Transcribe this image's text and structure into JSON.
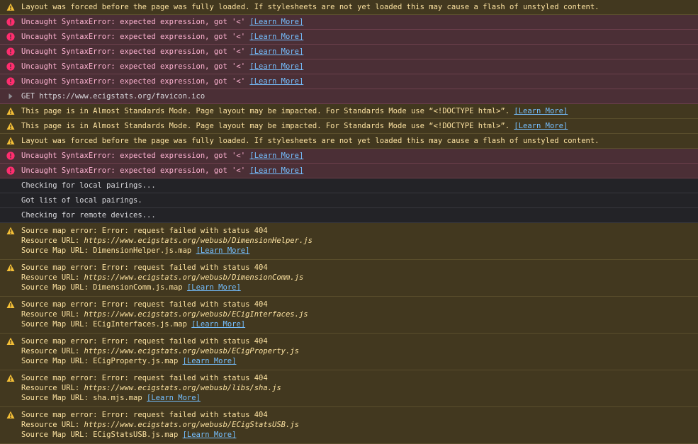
{
  "learn_more": "[Learn More]",
  "messages": [
    {
      "level": "warn",
      "text": "Layout was forced before the page was fully loaded. If stylesheets are not yet loaded this may cause a flash of unstyled content."
    },
    {
      "level": "error",
      "text": "Uncaught SyntaxError: expected expression, got '<'"
    },
    {
      "level": "error",
      "text": "Uncaught SyntaxError: expected expression, got '<'"
    },
    {
      "level": "error",
      "text": "Uncaught SyntaxError: expected expression, got '<'"
    },
    {
      "level": "error",
      "text": "Uncaught SyntaxError: expected expression, got '<'"
    },
    {
      "level": "error",
      "text": "Uncaught SyntaxError: expected expression, got '<'"
    },
    {
      "level": "net",
      "text": "GET https://www.ecigstats.org/favicon.ico"
    },
    {
      "level": "warn",
      "text": "This page is in Almost Standards Mode. Page layout may be impacted. For Standards Mode use “<!DOCTYPE html>”."
    },
    {
      "level": "warn",
      "text": "This page is in Almost Standards Mode. Page layout may be impacted. For Standards Mode use “<!DOCTYPE html>”."
    },
    {
      "level": "warn",
      "text": "Layout was forced before the page was fully loaded. If stylesheets are not yet loaded this may cause a flash of unstyled content."
    },
    {
      "level": "error",
      "text": "Uncaught SyntaxError: expected expression, got '<'"
    },
    {
      "level": "error",
      "text": "Uncaught SyntaxError: expected expression, got '<'"
    },
    {
      "level": "log",
      "text": "Checking for local pairings..."
    },
    {
      "level": "log",
      "text": "Got list of local pairings."
    },
    {
      "level": "log",
      "text": "Checking for remote devices..."
    }
  ],
  "source_map_errors": {
    "error_text": "Source map error: Error: request failed with status 404",
    "resource_label": "Resource URL: ",
    "map_label": "Source Map URL: ",
    "items": [
      {
        "resource": "https://www.ecigstats.org/webusb/DimensionHelper.js",
        "map": "DimensionHelper.js.map"
      },
      {
        "resource": "https://www.ecigstats.org/webusb/DimensionComm.js",
        "map": "DimensionComm.js.map"
      },
      {
        "resource": "https://www.ecigstats.org/webusb/ECigInterfaces.js",
        "map": "ECigInterfaces.js.map"
      },
      {
        "resource": "https://www.ecigstats.org/webusb/ECigProperty.js",
        "map": "ECigProperty.js.map"
      },
      {
        "resource": "https://www.ecigstats.org/webusb/libs/sha.js",
        "map": "sha.mjs.map"
      },
      {
        "resource": "https://www.ecigstats.org/webusb/ECigStatsUSB.js",
        "map": "ECigStatsUSB.js.map"
      }
    ]
  },
  "colors": {
    "warning": "#f5c037",
    "error": "#ff2d6f",
    "link": "#75bfff"
  },
  "icons": {
    "warn": "warning-icon",
    "error": "error-icon",
    "net": "expand-arrow-icon"
  }
}
